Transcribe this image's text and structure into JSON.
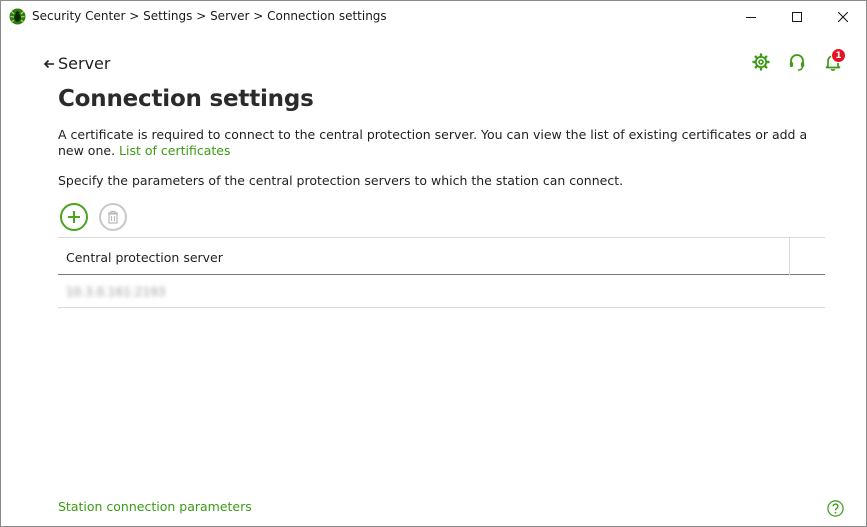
{
  "window": {
    "title": "Security Center > Settings > Server > Connection settings",
    "controls": [
      "minimize",
      "maximize",
      "close"
    ]
  },
  "header": {
    "back_label": "Server",
    "icons": [
      "gear-icon",
      "headset-icon",
      "bell-icon"
    ],
    "notification_count": "1"
  },
  "page": {
    "title": "Connection settings",
    "description": "A certificate is required to connect to the central protection server. You can view the list of existing certificates or add a new one.",
    "certificates_link": "List of certificates",
    "servers_description": "Specify the parameters of the central protection servers to which the station can connect."
  },
  "table": {
    "columns": [
      "Central protection server"
    ],
    "rows": [
      {
        "server": "10.3.0.161:2193"
      }
    ]
  },
  "footer": {
    "link": "Station connection parameters"
  },
  "colors": {
    "accent": "#3b9b15",
    "badge": "#e81123",
    "disabled": "#c8c8c8"
  }
}
